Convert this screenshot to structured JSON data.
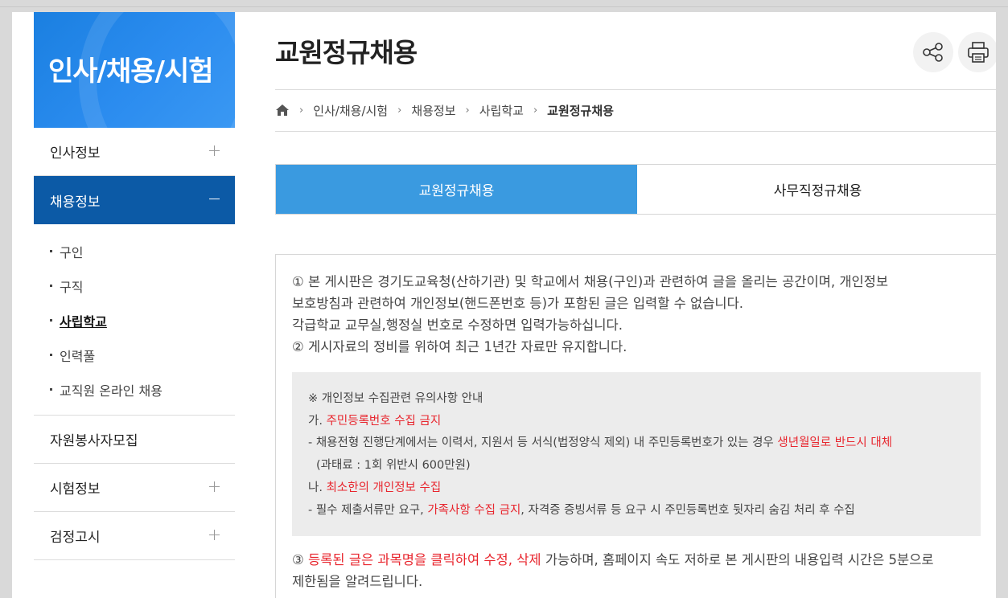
{
  "sidebar": {
    "banner_title": "인사/채용/시험",
    "menu": [
      {
        "label": "인사정보"
      },
      {
        "label": "채용정보"
      },
      {
        "label": "자원봉사자모집"
      },
      {
        "label": "시험정보"
      },
      {
        "label": "검정고시"
      }
    ],
    "submenu": [
      "구인",
      "구직",
      "사립학교",
      "인력풀",
      "교직원 온라인 채용"
    ]
  },
  "header": {
    "title": "교원정규채용",
    "share_icon": "share-icon",
    "print_icon": "print-icon"
  },
  "breadcrumb": [
    "인사/채용/시험",
    "채용정보",
    "사립학교",
    "교원정규채용"
  ],
  "tabs": [
    "교원정규채용",
    "사무직정규채용"
  ],
  "notice": {
    "line1": "① 본 게시판은 경기도교육청(산하기관) 및 학교에서 채용(구인)과 관련하여 글을 올리는 공간이며, 개인정보",
    "line2": "보호방침과 관련하여 개인정보(핸드폰번호 등)가 포함된 글은 입력할 수 없습니다.",
    "line3": "각급학교 교무실,행정실 번호로 수정하면 입력가능하십니다.",
    "line4": "② 게시자료의 정비를 위하여 최근 1년간 자료만 유지합니다.",
    "box": {
      "head": "※ 개인정보 수집관련 유의사항 안내",
      "a_prefix": "가. ",
      "a_red": "주민등록번호 수집 금지",
      "a_detail": "- 채용전형 진행단계에서는 이력서, 지원서 등 서식(법정양식 제외) 내 주민등록번호가 있는 경우 ",
      "a_detail_red": "생년월일로 반드시 대체",
      "a_fine": "(과태료 : 1회 위반시 600만원)",
      "b_prefix": "나. ",
      "b_red": "최소한의 개인정보 수집",
      "b_detail_1": "- 필수 제출서류만 요구, ",
      "b_detail_red": "가족사항 수집 금지",
      "b_detail_2": ", 자격증 증빙서류 등 요구 시 주민등록번호 뒷자리 숨김 처리 후 수집"
    },
    "line5_prefix": "③ ",
    "line5_red": "등록된 글은 과목명을 클릭하여 수정, 삭제",
    "line5_rest": " 가능하며, 홈페이지 속도 저하로 본 게시판의 내용입력 시간은 5분으로",
    "line6": "제한됨을 알려드립니다."
  }
}
